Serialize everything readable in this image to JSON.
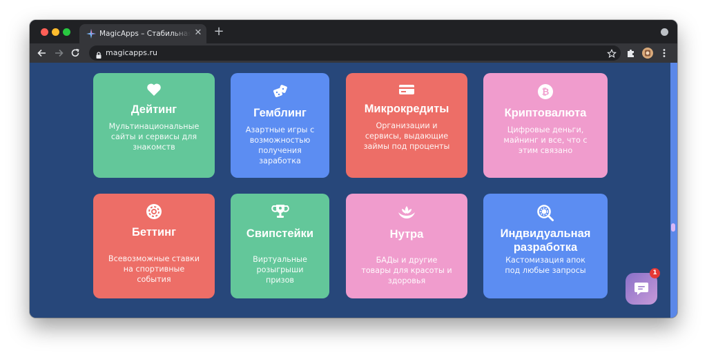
{
  "browser": {
    "tab_title": "MagicApps – Стабильная работа",
    "url": "magicapps.ru",
    "window_colors": {
      "close": "#ff5f57",
      "minimize": "#febc2e",
      "maximize": "#28c840"
    }
  },
  "cards": [
    {
      "title": "Дейтинг",
      "desc": [
        "Мультинациональные",
        "сайты и сервисы для",
        "знакомств"
      ],
      "color": "#63c79a",
      "icon": "heart-icon"
    },
    {
      "title": "Гемблинг",
      "desc": [
        "Азартные игры с",
        "возможностью",
        "получения",
        "заработка"
      ],
      "color": "#5c8df2",
      "icon": "dice-icon"
    },
    {
      "title": "Микрокредиты",
      "desc": [
        "Организации и",
        "сервисы, выдающие",
        "займы под проценты"
      ],
      "color": "#ed6e67",
      "icon": "credit-card-icon"
    },
    {
      "title": "Криптовалюта",
      "desc": [
        "Цифровые деньги,",
        "майнинг и все, что с",
        "этим связано"
      ],
      "color": "#f09ccd",
      "icon": "bitcoin-icon"
    },
    {
      "title": "Беттинг",
      "desc": [
        "Всевозможные ставки",
        "на спортивные",
        "события"
      ],
      "color": "#ed6e67",
      "icon": "chip-icon"
    },
    {
      "title": "Свипстейки",
      "desc": [
        "Виртуальные",
        "розыгрыши",
        "призов"
      ],
      "color": "#63c79a",
      "icon": "trophy-icon"
    },
    {
      "title": "Нутра",
      "desc": [
        "БАДы и другие",
        "товары для красоты и",
        "здоровья"
      ],
      "color": "#f09ccd",
      "icon": "lotus-hands-icon"
    },
    {
      "title": "Индвидуальная разработка",
      "title_lines": [
        "Индвидуальная",
        "разработка"
      ],
      "desc": [
        "Кастомизация апок",
        "под любые запросы"
      ],
      "color": "#5c8df2",
      "icon": "gear-search-icon"
    }
  ],
  "chat": {
    "badge_count": "1",
    "icon": "chat-icon"
  }
}
